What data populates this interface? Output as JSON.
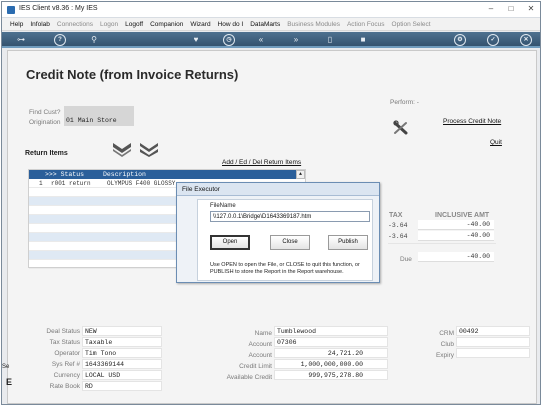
{
  "window": {
    "title": "IES Client v8.36 : My IES"
  },
  "menu": {
    "items": [
      {
        "label": "Help",
        "dim": false
      },
      {
        "label": "Infolab",
        "dim": false
      },
      {
        "label": "Connections",
        "dim": true
      },
      {
        "label": "Logon",
        "dim": true
      },
      {
        "label": "Logoff",
        "dim": false
      },
      {
        "label": "Companion",
        "dim": false
      },
      {
        "label": "Wizard",
        "dim": false
      },
      {
        "label": "How do I",
        "dim": false
      },
      {
        "label": "DataMarts",
        "dim": false
      },
      {
        "label": "Business Modules",
        "dim": true
      },
      {
        "label": "Action Focus",
        "dim": true
      },
      {
        "label": "Option Select",
        "dim": true
      }
    ]
  },
  "toolbar": {
    "icons": [
      "key-icon",
      "help-icon",
      "search-icon",
      "heart-icon",
      "clock-icon",
      "rewind-icon",
      "fast-forward-icon",
      "stop-icon",
      "gear-icon",
      "check-icon",
      "close-icon"
    ]
  },
  "page": {
    "title": "Credit Note (from Invoice Returns)",
    "perform_label": "Perform: -",
    "process_link": "Process Credit Note",
    "quit_link": "Quit",
    "find_cust_label": "Find Cust?",
    "origination_label": "Origination",
    "origination_value": "01 Main Store",
    "return_items_label": "Return Items",
    "add_edit_link": "Add / Ed / Del Return Items"
  },
  "grid": {
    "columns": [
      ">>> Status",
      "Description"
    ],
    "rows": [
      {
        "num": "1",
        "status": "r001 return",
        "description": "OLYMPUS F400 GLOSSY"
      }
    ],
    "scroll_up": "▲"
  },
  "totals": {
    "tax_header": "TAX",
    "inclusive_header": "INCLUSIVE AMT",
    "tax_values": [
      "-3.64",
      "-3.64"
    ],
    "inclusive_values": [
      "-40.00",
      "-40.00"
    ],
    "due_label": "Due",
    "due_value": "-40.00"
  },
  "dialog": {
    "title": "File Executor",
    "filename_label": "FileName",
    "filename_value": "\\\\127.0.0.1\\Bridge\\D1643369187.htm",
    "open_label": "Open",
    "close_label": "Close",
    "publish_label": "Publish",
    "note": "Use OPEN to open the File, or CLOSE to quit this function, or PUBLISH to store the Report in the Report warehouse."
  },
  "deal": {
    "status_label": "Deal Status",
    "status_value": "NEW",
    "tax_status_label": "Tax Status",
    "tax_status_value": "Taxable",
    "operator_label": "Operator",
    "operator_value": "Tim Tono",
    "sys_ref_label": "Sys Ref #",
    "sys_ref_value": "1643369144",
    "currency_label": "Currency",
    "currency_value": "LOCAL USD",
    "rate_book_label": "Rate Book",
    "rate_book_value": "RD"
  },
  "account": {
    "name_label": "Name",
    "name_value": "Tumblewood",
    "account_label": "Account",
    "account_value": "07306",
    "account2_label": "Account",
    "account2_value": "24,721.20",
    "credit_limit_label": "Credit Limit",
    "credit_limit_value": "1,000,000,000.00",
    "available_label": "Available Credit",
    "available_value": "999,975,278.80"
  },
  "crm": {
    "crm_label": "CRM",
    "crm_value": "00492",
    "club_label": "Club",
    "expiry_label": "Expiry"
  },
  "side_fragment": {
    "top": "Se",
    "bottom": "E"
  }
}
